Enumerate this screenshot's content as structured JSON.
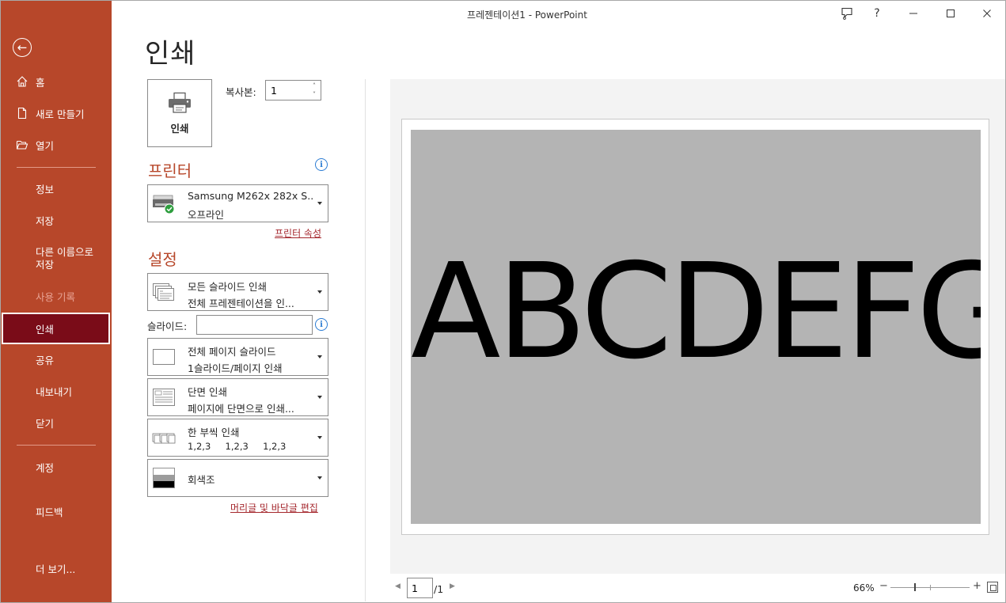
{
  "window": {
    "title": "프레젠테이션1  -  PowerPoint"
  },
  "sidebar": {
    "items": [
      {
        "label": "홈"
      },
      {
        "label": "새로 만들기"
      },
      {
        "label": "열기"
      },
      {
        "label": "정보"
      },
      {
        "label": "저장"
      },
      {
        "label": "다른 이름으로\n저장"
      },
      {
        "label": "사용 기록"
      },
      {
        "label": "인쇄"
      },
      {
        "label": "공유"
      },
      {
        "label": "내보내기"
      },
      {
        "label": "닫기"
      },
      {
        "label": "계정"
      },
      {
        "label": "피드백"
      },
      {
        "label": "더 보기..."
      }
    ]
  },
  "print": {
    "heading": "인쇄",
    "button_label": "인쇄",
    "copies_label": "복사본:",
    "copies_value": "1"
  },
  "printer": {
    "section_title": "프린터",
    "name": "Samsung M262x 282x S...",
    "status": "오프라인",
    "properties_link": "프린터 속성"
  },
  "settings": {
    "section_title": "설정",
    "slides_mode": {
      "line1": "모든 슬라이드 인쇄",
      "line2": "전체 프레젠테이션을 인..."
    },
    "slides_label": "슬라이드:",
    "slides_value": "",
    "layout": {
      "line1": "전체 페이지 슬라이드",
      "line2": "1슬라이드/페이지 인쇄"
    },
    "sides": {
      "line1": "단면 인쇄",
      "line2": "페이지에 단면으로 인쇄..."
    },
    "collate": {
      "line1": "한 부씩 인쇄",
      "line2": "1,2,3     1,2,3     1,2,3"
    },
    "color": {
      "line1": "회색조"
    },
    "header_footer_link": "머리글 및 바닥글 편집"
  },
  "preview": {
    "slide_text": "ABCDEFG",
    "slide_bg": "#b4b4b4",
    "current_page": "1",
    "total_pages": "/1",
    "zoom": "66%"
  },
  "colors": {
    "sidebar_bg": "#b7472a",
    "active_item_bg": "#7a0c18",
    "accent_text": "#b7472a",
    "link": "#a4262c",
    "info": "#2b7cd3"
  }
}
